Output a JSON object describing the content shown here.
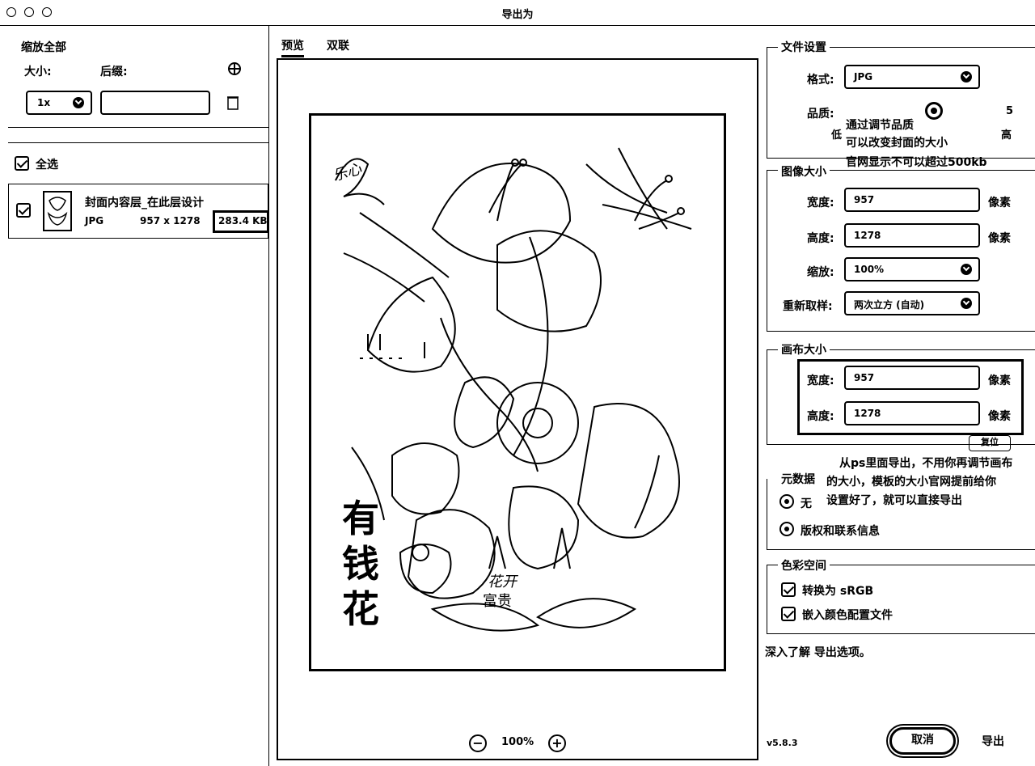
{
  "window": {
    "title": "导出为"
  },
  "left_panel": {
    "scale_all_label": "缩放全部",
    "size_label": "大小:",
    "suffix_label": "后缀:",
    "scale_value": "1x",
    "suffix_value": "",
    "select_all_label": "全选",
    "layer": {
      "name": "封面内容层_在此层设计",
      "format": "JPG",
      "dimensions": "957 x 1278",
      "file_size": "283.4 KB"
    }
  },
  "preview": {
    "tabs": [
      "预览",
      "双联"
    ],
    "active_tab": "预览",
    "zoom": "100%",
    "artwork_text": {
      "headline": "有钱花",
      "caption_line1": "花开",
      "caption_line2": "富贵",
      "signature": "乐心"
    }
  },
  "file_settings": {
    "section_title": "文件设置",
    "format_label": "格式:",
    "format_value": "JPG",
    "quality_label": "品质:",
    "quality_value": "5",
    "quality_low": "低",
    "quality_high": "高",
    "note_line1": "通过调节品质",
    "note_line2": "可以改变封面的大小",
    "note_line3": "官网显示不可以超过500kb"
  },
  "image_size": {
    "section_title": "图像大小",
    "width_label": "宽度:",
    "width_value": "957",
    "height_label": "高度:",
    "height_value": "1278",
    "unit": "像素",
    "scale_label": "缩放:",
    "scale_value": "100%",
    "resample_label": "重新取样:",
    "resample_value": "两次立方 (自动)"
  },
  "canvas_size": {
    "section_title": "画布大小",
    "width_label": "宽度:",
    "width_value": "957",
    "height_label": "高度:",
    "height_value": "1278",
    "unit": "像素",
    "reset_label": "复位",
    "note_line1": "从ps里面导出，不用你再调节画布",
    "note_line2": "的大小，模板的大小官网提前给你",
    "note_line3": "设置好了，就可以直接导出"
  },
  "metadata": {
    "section_title": "元数据",
    "option_none": "无",
    "option_copyright": "版权和联系信息"
  },
  "color_space": {
    "section_title": "色彩空间",
    "convert_srgb": "转换为 sRGB",
    "embed_profile": "嵌入颜色配置文件"
  },
  "footer": {
    "learn_more": "深入了解 导出选项。",
    "version": "v5.8.3",
    "cancel_label": "取消",
    "export_label": "导出"
  }
}
